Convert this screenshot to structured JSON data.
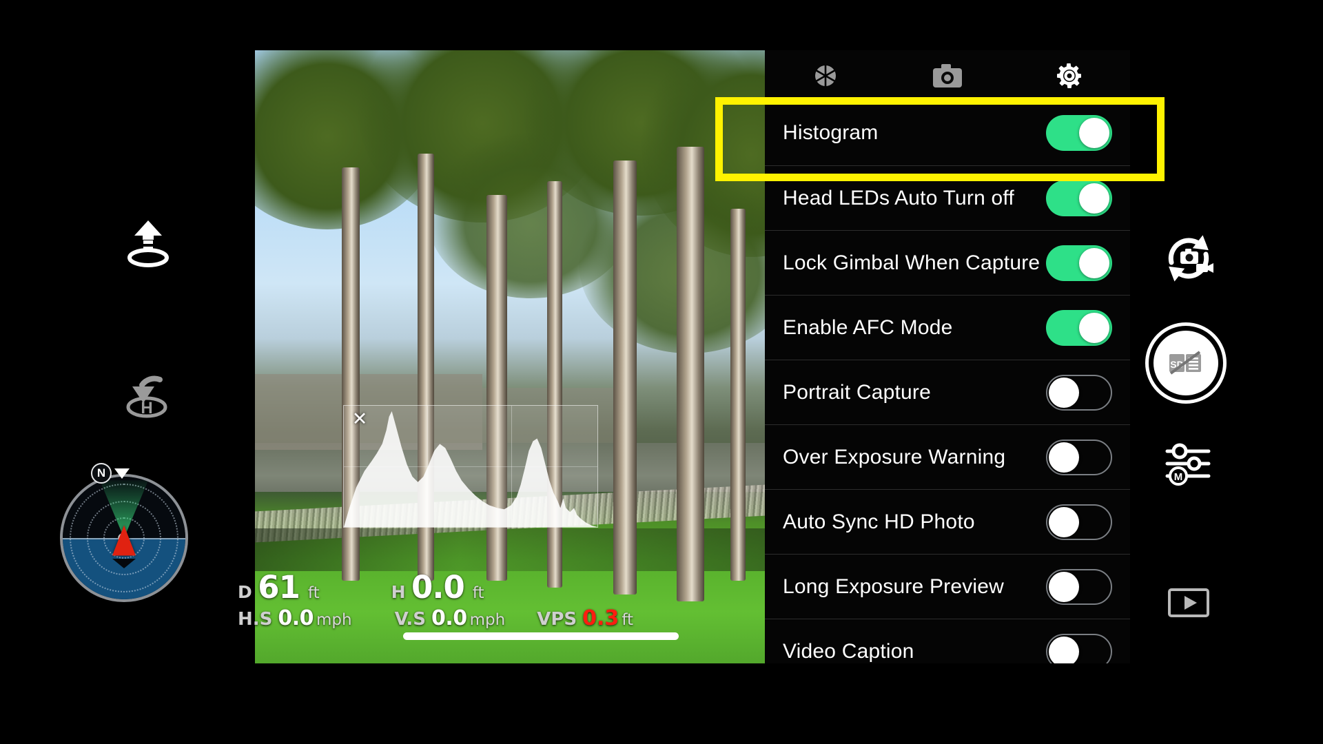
{
  "app": {
    "title": "Drone Camera Live View"
  },
  "video": {
    "histogram": {
      "visible": true,
      "close_label": "✕",
      "curve": "0,178 8,150 18,120 30,96 40,82 48,70 56,56 62,36 66,16 70,8 76,30 84,60 92,86 100,104 108,112 116,104 124,86 132,66 140,56 148,62 156,78 164,96 172,110 182,122 192,132 202,140 212,146 224,150 234,152 244,146 252,134 258,116 264,92 270,66 276,52 282,48 288,62 294,86 300,110 306,128 312,140 316,150 320,136 324,150 330,156 336,150 340,160 346,166 354,172 362,176 370,178"
    },
    "telemetry": {
      "distance": {
        "label": "D",
        "value": "61",
        "unit": "ft"
      },
      "height": {
        "label": "H",
        "value": "0.0",
        "unit": "ft"
      },
      "horizontal_speed": {
        "label": "H.S",
        "value": "0.0",
        "unit": "mph"
      },
      "vertical_speed": {
        "label": "V.S",
        "value": "0.0",
        "unit": "mph"
      },
      "vps": {
        "label": "VPS",
        "value": "0.3",
        "unit": "ft",
        "value_color": "#ff1d10"
      }
    }
  },
  "left_controls": {
    "takeoff": {
      "name": "takeoff-button",
      "tooltip": "Auto Takeoff"
    },
    "return_to_home": {
      "name": "return-to-home-button",
      "tooltip": "Return To Home",
      "glyph": "H"
    },
    "radar": {
      "north_label": "N",
      "heading_indicator": "aircraft-arrow"
    }
  },
  "right_controls": {
    "switch_camera_mode": {
      "tooltip": "Switch Photo / Video"
    },
    "shutter": {
      "tooltip": "Shutter",
      "status_icon": "sd-card-slash",
      "sd_text": "SD"
    },
    "camera_settings": {
      "tooltip": "Camera Settings",
      "mode_glyph": "M"
    },
    "playback": {
      "tooltip": "Playback"
    }
  },
  "settings": {
    "tabs": [
      {
        "id": "exposure",
        "icon": "aperture-icon",
        "selected": false
      },
      {
        "id": "camera",
        "icon": "camera-icon",
        "selected": false
      },
      {
        "id": "general",
        "icon": "gear-icon",
        "selected": true
      }
    ],
    "items": [
      {
        "label": "Histogram",
        "on": true,
        "highlighted": true
      },
      {
        "label": "Head LEDs Auto Turn off",
        "on": true,
        "highlighted": false
      },
      {
        "label": "Lock Gimbal When Capture",
        "on": true,
        "highlighted": false
      },
      {
        "label": "Enable AFC Mode",
        "on": true,
        "highlighted": false
      },
      {
        "label": "Portrait Capture",
        "on": false,
        "highlighted": false
      },
      {
        "label": "Over Exposure Warning",
        "on": false,
        "highlighted": false
      },
      {
        "label": "Auto Sync HD Photo",
        "on": false,
        "highlighted": false
      },
      {
        "label": "Long Exposure Preview",
        "on": false,
        "highlighted": false
      },
      {
        "label": "Video Caption",
        "on": false,
        "highlighted": false
      }
    ]
  },
  "annotation": {
    "highlight_color": "#fff200",
    "target": "Histogram"
  },
  "colors": {
    "toggle_on": "#2ee088",
    "toggle_off_border": "#7b7f84",
    "panel_bg": "#060606",
    "accent_warning": "#ff1d10",
    "highlight": "#fff200"
  }
}
